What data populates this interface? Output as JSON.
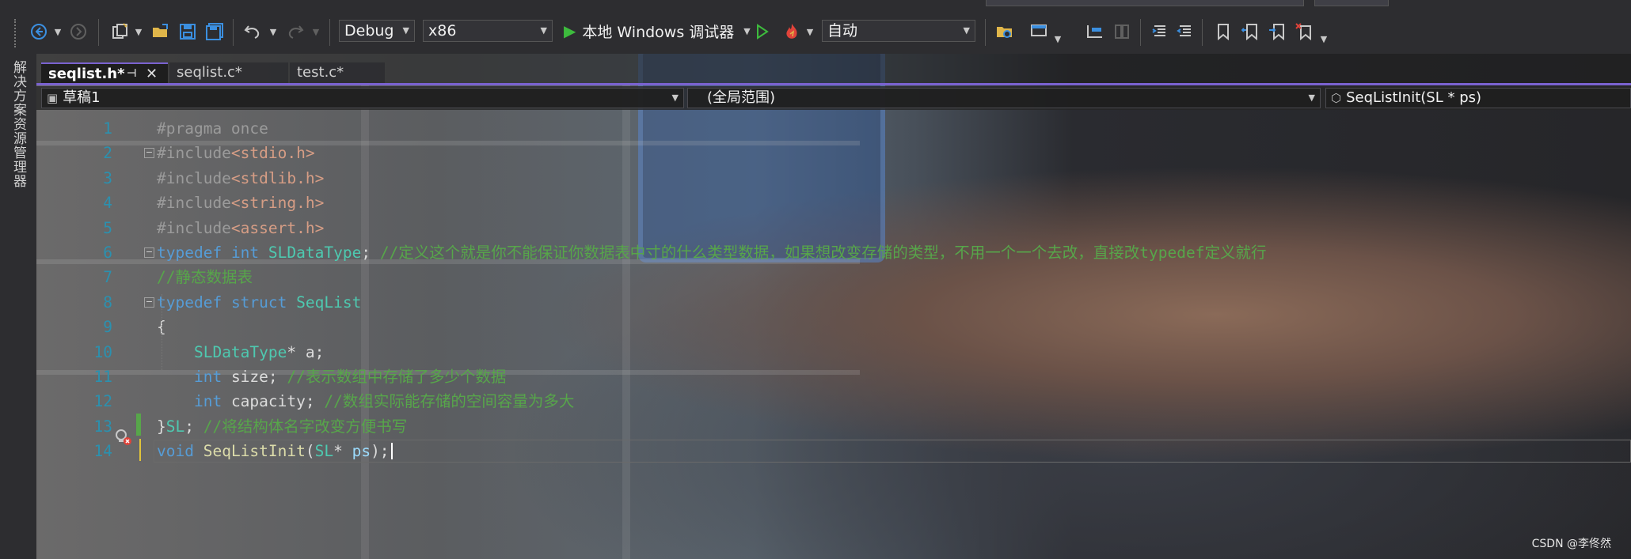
{
  "menu": {
    "items": []
  },
  "toolbar": {
    "config": "Debug",
    "platform": "x86",
    "run_label": "本地 Windows 调试器",
    "stack": "自动",
    "icons": [
      "back-icon",
      "forward-icon",
      "new-project-icon",
      "add-item-icon",
      "open-file-icon",
      "save-icon",
      "save-all-icon",
      "undo-icon",
      "redo-icon",
      "start-without-debug-icon",
      "hot-reload-icon",
      "solution-explorer-icon",
      "layout-icon",
      "breakpoint-step-icon",
      "step-into-icon",
      "comment-icon",
      "uncomment-icon",
      "bookmark-icon",
      "prev-bookmark-icon",
      "next-bookmark-icon",
      "clear-bookmarks-icon"
    ]
  },
  "side_panel": {
    "label": "解决方案资源管理器"
  },
  "tabs": [
    {
      "label": "seqlist.h*",
      "active": true
    },
    {
      "label": "seqlist.c*",
      "active": false
    },
    {
      "label": "test.c*",
      "active": false
    }
  ],
  "nav": {
    "project": "草稿1",
    "scope": "(全局范围)",
    "member": "SeqListInit(SL * ps)"
  },
  "code": {
    "lines": [
      {
        "n": "1",
        "tokens": [
          [
            "pp",
            "#pragma once"
          ]
        ]
      },
      {
        "n": "2",
        "tokens": [
          [
            "pp",
            "#include"
          ],
          [
            "inc",
            "<stdio.h>"
          ]
        ]
      },
      {
        "n": "3",
        "tokens": [
          [
            "pp",
            "#include"
          ],
          [
            "inc",
            "<stdlib.h>"
          ]
        ]
      },
      {
        "n": "4",
        "tokens": [
          [
            "pp",
            "#include"
          ],
          [
            "inc",
            "<string.h>"
          ]
        ]
      },
      {
        "n": "5",
        "tokens": [
          [
            "pp",
            "#include"
          ],
          [
            "inc",
            "<assert.h>"
          ]
        ]
      },
      {
        "n": "6",
        "tokens": [
          [
            "kw",
            "typedef"
          ],
          [
            "tx",
            " "
          ],
          [
            "kw",
            "int"
          ],
          [
            "tx",
            " "
          ],
          [
            "ty",
            "SLDataType"
          ],
          [
            "tx",
            "; "
          ],
          [
            "cm",
            "//定义这个就是你不能保证你数据表中寸的什么类型数据，如果想改变存储的类型，不用一个一个去改，直接改typedef定义就行"
          ]
        ]
      },
      {
        "n": "7",
        "tokens": [
          [
            "cm",
            "//静态数据表"
          ]
        ]
      },
      {
        "n": "8",
        "tokens": [
          [
            "kw",
            "typedef"
          ],
          [
            "tx",
            " "
          ],
          [
            "kw",
            "struct"
          ],
          [
            "tx",
            " "
          ],
          [
            "ty",
            "SeqList"
          ]
        ]
      },
      {
        "n": "9",
        "tokens": [
          [
            "tx",
            "{"
          ]
        ]
      },
      {
        "n": "10",
        "tokens": [
          [
            "tx",
            "    "
          ],
          [
            "ty",
            "SLDataType"
          ],
          [
            "tx",
            "* a;"
          ]
        ]
      },
      {
        "n": "11",
        "tokens": [
          [
            "tx",
            "    "
          ],
          [
            "kw",
            "int"
          ],
          [
            "tx",
            " size; "
          ],
          [
            "cm",
            "//表示数组中存储了多少个数据"
          ]
        ]
      },
      {
        "n": "12",
        "tokens": [
          [
            "tx",
            "    "
          ],
          [
            "kw",
            "int"
          ],
          [
            "tx",
            " capacity; "
          ],
          [
            "cm",
            "//数组实际能存储的空间容量为多大"
          ]
        ]
      },
      {
        "n": "13",
        "tokens": [
          [
            "tx",
            "}"
          ],
          [
            "ty",
            "SL"
          ],
          [
            "tx",
            "; "
          ],
          [
            "cm",
            "//将结构体名字改变方便书写"
          ]
        ]
      },
      {
        "n": "14",
        "tokens": [
          [
            "kw",
            "void"
          ],
          [
            "tx",
            " "
          ],
          [
            "fn",
            "SeqListInit"
          ],
          [
            "tx",
            "("
          ],
          [
            "ty",
            "SL"
          ],
          [
            "tx",
            "* "
          ],
          [
            "pm",
            "ps"
          ],
          [
            "tx",
            ");"
          ]
        ]
      }
    ]
  },
  "watermark": "CSDN @李佟然",
  "colors": {
    "keyword": "#569cd6",
    "type": "#4ec9b0",
    "include": "#d69d85",
    "comment": "#57a64a",
    "line_number": "#2b91af",
    "accent": "#7a62d0"
  }
}
